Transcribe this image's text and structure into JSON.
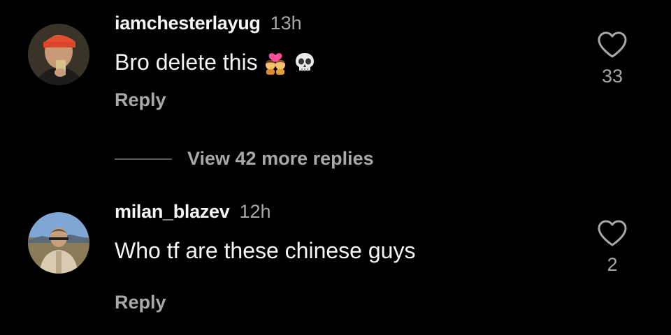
{
  "comments": [
    {
      "username": "iamchesterlayug",
      "time": "13h",
      "text": "Bro delete this",
      "emojis": [
        "kissing-couple-emoji",
        "skull-emoji"
      ],
      "reply_label": "Reply",
      "like_count": "33"
    },
    {
      "username": "milan_blazev",
      "time": "12h",
      "text": "Who tf are these chinese guys",
      "emojis": [],
      "reply_label": "Reply",
      "like_count": "2"
    }
  ],
  "view_replies": {
    "label": "View 42 more replies"
  },
  "colors": {
    "background": "#000000",
    "primary_text": "#f5f5f5",
    "secondary_text": "#a8a8a8",
    "divider": "#5a5a5a"
  }
}
